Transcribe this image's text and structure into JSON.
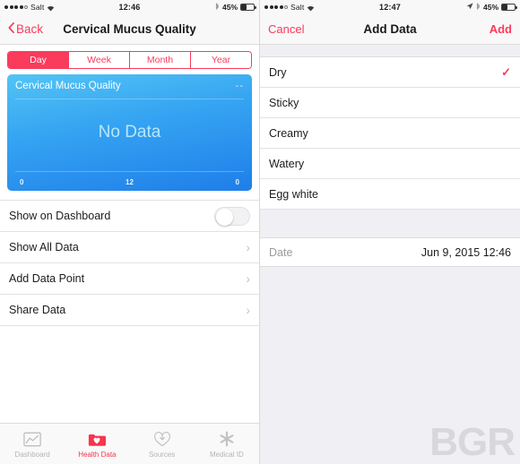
{
  "left": {
    "statusbar": {
      "carrier": "Salt",
      "signal_filled": 4,
      "signal_total": 5,
      "wifi_icon": "wifi-icon",
      "time": "12:46",
      "bluetooth_icon": "bluetooth-icon",
      "battery_pct": "45%",
      "battery_level": 45
    },
    "nav": {
      "back_label": "Back",
      "back_icon": "chevron-left-icon",
      "title": "Cervical Mucus Quality"
    },
    "segments": [
      {
        "label": "Day",
        "active": true
      },
      {
        "label": "Week",
        "active": false
      },
      {
        "label": "Month",
        "active": false
      },
      {
        "label": "Year",
        "active": false
      }
    ],
    "chart_card": {
      "title": "Cervical Mucus Quality",
      "value": "--",
      "empty_text": "No Data",
      "axis_left": "0",
      "axis_center": "12",
      "axis_right": "0"
    },
    "rows": [
      {
        "label": "Show on Dashboard",
        "accessory": "toggle",
        "toggle_on": false
      },
      {
        "label": "Show All Data",
        "accessory": "chevron"
      },
      {
        "label": "Add Data Point",
        "accessory": "chevron"
      },
      {
        "label": "Share Data",
        "accessory": "chevron"
      }
    ],
    "tabs": [
      {
        "label": "Dashboard",
        "icon": "dashboard-chart-icon",
        "active": false
      },
      {
        "label": "Health Data",
        "icon": "health-data-folder-heart-icon",
        "active": true
      },
      {
        "label": "Sources",
        "icon": "sources-download-heart-icon",
        "active": false
      },
      {
        "label": "Medical ID",
        "icon": "medical-id-asterisk-icon",
        "active": false
      }
    ]
  },
  "right": {
    "statusbar": {
      "carrier": "Salt",
      "signal_filled": 4,
      "signal_total": 5,
      "wifi_icon": "wifi-icon",
      "time": "12:47",
      "location_icon": "location-arrow-icon",
      "bluetooth_icon": "bluetooth-icon",
      "battery_pct": "45%",
      "battery_level": 45
    },
    "nav": {
      "cancel_label": "Cancel",
      "title": "Add Data",
      "add_label": "Add"
    },
    "options": [
      {
        "label": "Dry",
        "selected": true
      },
      {
        "label": "Sticky",
        "selected": false
      },
      {
        "label": "Creamy",
        "selected": false
      },
      {
        "label": "Watery",
        "selected": false
      },
      {
        "label": "Egg white",
        "selected": false
      }
    ],
    "date": {
      "label": "Date",
      "value": "Jun 9, 2015  12:46"
    },
    "watermark": "BGR"
  },
  "colors": {
    "accent_pink": "#fb3b5c",
    "chart_top": "#53c4f5",
    "chart_bottom": "#1f7ee9",
    "group_bg": "#efeff4"
  }
}
